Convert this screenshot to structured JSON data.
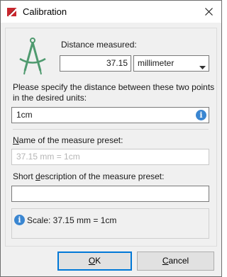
{
  "window": {
    "title": "Calibration",
    "close_glyph": "close-icon"
  },
  "distance": {
    "label": "Distance measured:",
    "value": "37.15",
    "unit_selected": "millimeter"
  },
  "specify": {
    "label_line1": "Please specify the distance between these two points",
    "label_line2": "in the desired units:",
    "value": "1cm"
  },
  "preset_name": {
    "label_mnemonic": "N",
    "label_rest": "ame of the measure preset:",
    "placeholder": "37.15 mm = 1cm"
  },
  "preset_desc": {
    "label_pre": "Short ",
    "label_mnemonic": "d",
    "label_rest": "escription of the measure preset:",
    "value": ""
  },
  "scale": {
    "text": "Scale: 37.15 mm = 1cm"
  },
  "buttons": {
    "ok_mnemonic": "O",
    "ok_rest": "K",
    "cancel_mnemonic": "C",
    "cancel_rest": "ancel"
  },
  "colors": {
    "accent": "#0078d7",
    "info": "#3a86d1",
    "icon_red": "#c8262d",
    "compass_green": "#4f9a6f"
  },
  "icons": {
    "app": "app-icon",
    "compass": "compass-icon",
    "info": "info-icon",
    "dropdown": "chevron-down-icon"
  }
}
